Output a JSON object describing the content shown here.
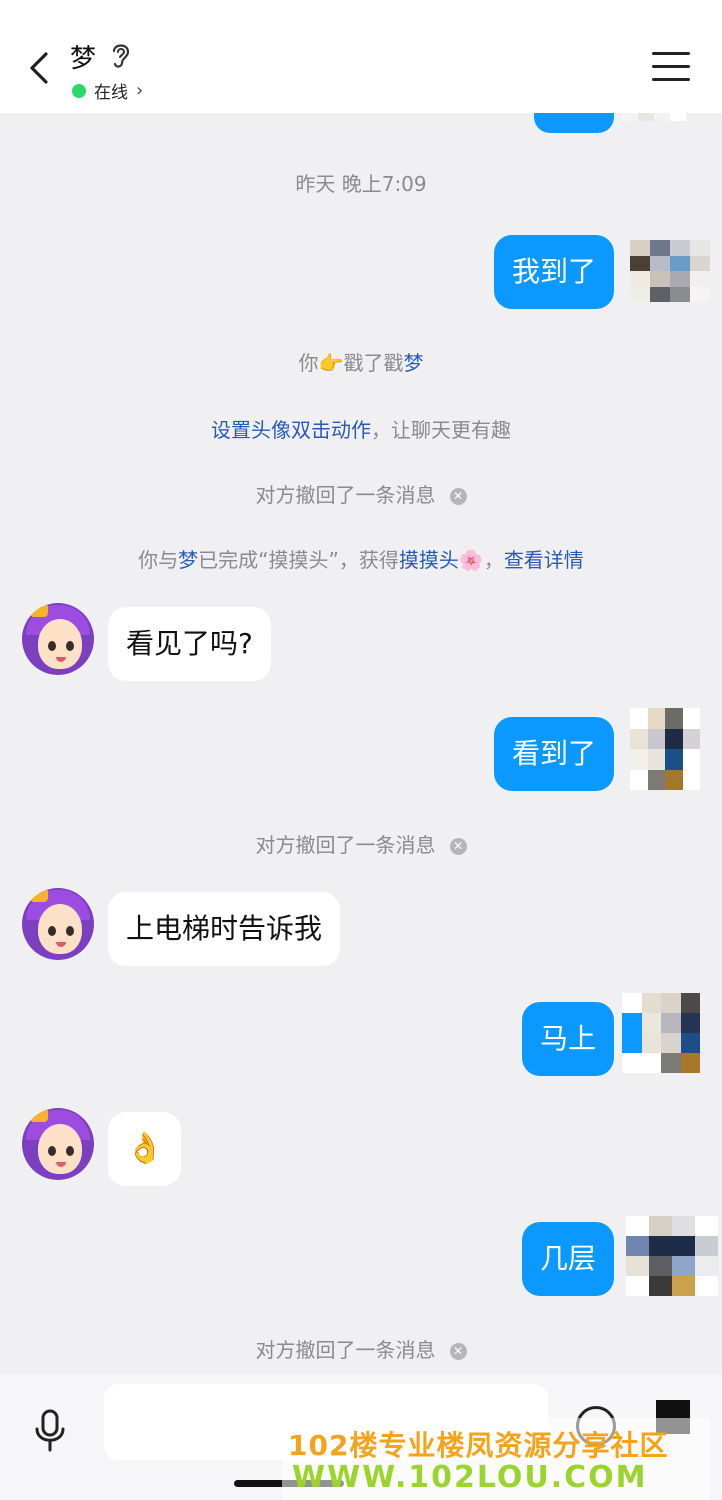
{
  "header": {
    "contact_name": "梦",
    "status_text": "在线",
    "status_chevron": "›",
    "icons": [
      "back-arrow-icon",
      "ear-icon",
      "hamburger-menu-icon"
    ]
  },
  "messages": {
    "timestamp": "昨天 晚上7:09",
    "m1": "我到了",
    "poke_prefix": "你",
    "poke_emoji": "👉",
    "poke_middle": "戳了戳",
    "poke_target": "梦",
    "tip_link": "设置头像双击动作",
    "tip_rest": "，让聊天更有趣",
    "recall1": "对方撤回了一条消息",
    "achv_prefix": "你与",
    "achv_name": "梦",
    "achv_middle": "已完成“摸摸头”，获得",
    "achv_badge": "摸摸头",
    "achv_flower": "🌸",
    "achv_comma": "，",
    "achv_link": "查看详情",
    "m2": "看见了吗?",
    "m3": "看到了",
    "recall2": "对方撤回了一条消息",
    "m4": "上电梯时告诉我",
    "m5": "马上",
    "m6": "👌",
    "m7": "几层",
    "recall3": "对方撤回了一条消息"
  },
  "bottom": {
    "icons": [
      "microphone-icon",
      "emoji-icon",
      "plus-icon"
    ]
  },
  "watermark": {
    "line1": "102楼专业楼凤资源分享社区",
    "line2": "WWW.102LOU.COM"
  },
  "colors": {
    "my_bubble": "#0b99ff",
    "their_bubble": "#ffffff",
    "link_blue": "#2a5ab7",
    "online_green": "#2bd96a",
    "background": "#f0f0f2"
  }
}
